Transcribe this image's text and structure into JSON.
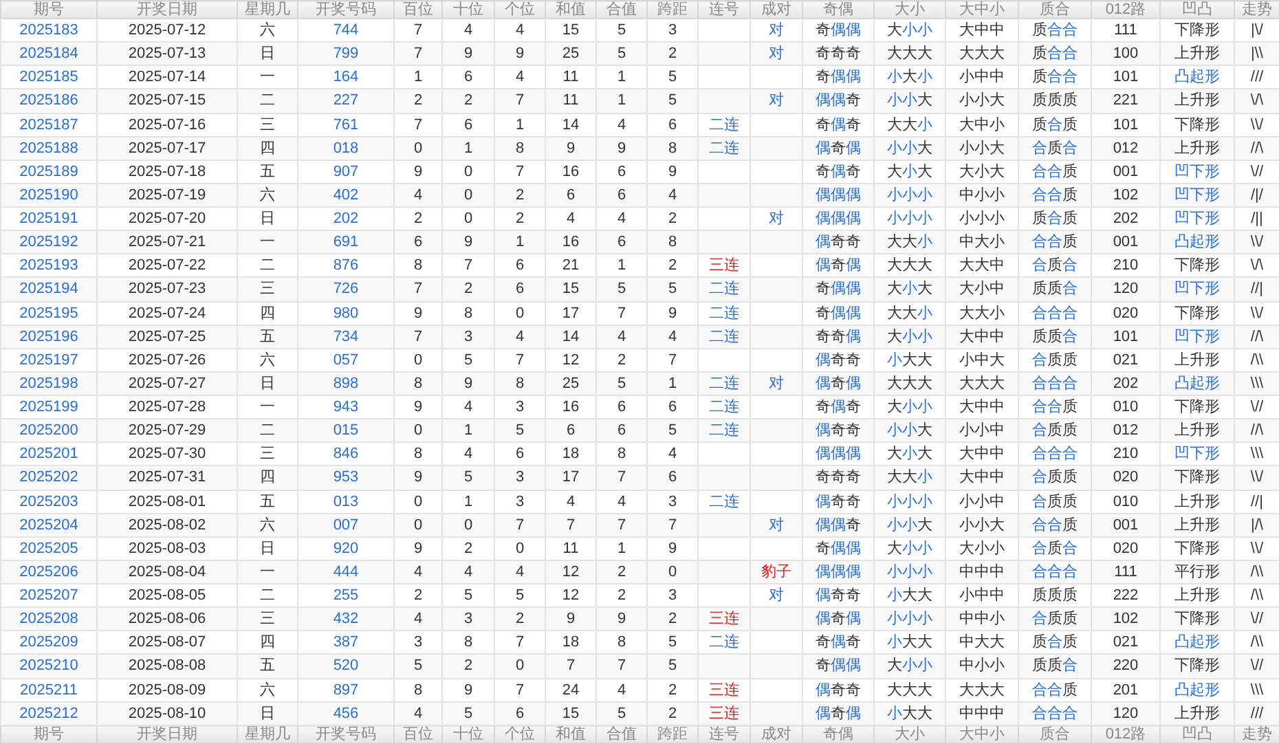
{
  "columns": [
    "期号",
    "开奖日期",
    "星期几",
    "开奖号码",
    "百位",
    "十位",
    "个位",
    "和值",
    "合值",
    "跨距",
    "连号",
    "成对",
    "奇偶",
    "大小",
    "大中小",
    "质合",
    "012路",
    "凹凸",
    "走势"
  ],
  "rows": [
    {
      "period": "2025183",
      "date": "2025-07-12",
      "weekday": "六",
      "number": "744",
      "hundreds": "7",
      "tens": "4",
      "units": "4",
      "sum": "15",
      "sum_tail": "5",
      "span": "3",
      "odd_even": [
        "奇",
        "偶",
        "偶"
      ],
      "odd_even_accent": [
        false,
        true,
        true
      ],
      "big_small": [
        "大",
        "小",
        "小"
      ],
      "big_small_accent": [
        false,
        true,
        true
      ],
      "big_mid_small": "大中中",
      "prime_composite": [
        "质",
        "合",
        "合"
      ],
      "prime_composite_accent": [
        false,
        true,
        true
      ],
      "route_012": "111",
      "shape": "下降形",
      "shape_accent": false,
      "trend": "|\\/",
      "pair": {
        "text": "对",
        "color": "#2a6fd6"
      }
    },
    {
      "period": "2025184",
      "date": "2025-07-13",
      "weekday": "日",
      "number": "799",
      "hundreds": "7",
      "tens": "9",
      "units": "9",
      "sum": "25",
      "sum_tail": "5",
      "span": "2",
      "odd_even": [
        "奇",
        "奇",
        "奇"
      ],
      "odd_even_accent": [
        false,
        false,
        false
      ],
      "big_small": [
        "大",
        "大",
        "大"
      ],
      "big_small_accent": [
        false,
        false,
        false
      ],
      "big_mid_small": "大大大",
      "prime_composite": [
        "质",
        "合",
        "合"
      ],
      "prime_composite_accent": [
        false,
        true,
        true
      ],
      "route_012": "100",
      "shape": "上升形",
      "shape_accent": false,
      "trend": "|\\\\",
      "pair": {
        "text": "对",
        "color": "#2a6fd6"
      }
    },
    {
      "period": "2025185",
      "date": "2025-07-14",
      "weekday": "一",
      "number": "164",
      "hundreds": "1",
      "tens": "6",
      "units": "4",
      "sum": "11",
      "sum_tail": "1",
      "span": "5",
      "odd_even": [
        "奇",
        "偶",
        "偶"
      ],
      "odd_even_accent": [
        false,
        true,
        true
      ],
      "big_small": [
        "小",
        "大",
        "小"
      ],
      "big_small_accent": [
        true,
        false,
        true
      ],
      "big_mid_small": "小中中",
      "prime_composite": [
        "质",
        "合",
        "合"
      ],
      "prime_composite_accent": [
        false,
        true,
        true
      ],
      "route_012": "101",
      "shape": "凸起形",
      "shape_accent": true,
      "trend": "///"
    },
    {
      "period": "2025186",
      "date": "2025-07-15",
      "weekday": "二",
      "number": "227",
      "hundreds": "2",
      "tens": "2",
      "units": "7",
      "sum": "11",
      "sum_tail": "1",
      "span": "5",
      "odd_even": [
        "偶",
        "偶",
        "奇"
      ],
      "odd_even_accent": [
        true,
        true,
        false
      ],
      "big_small": [
        "小",
        "小",
        "大"
      ],
      "big_small_accent": [
        true,
        true,
        false
      ],
      "big_mid_small": "小小大",
      "prime_composite": [
        "质",
        "质",
        "质"
      ],
      "prime_composite_accent": [
        false,
        false,
        false
      ],
      "route_012": "221",
      "shape": "上升形",
      "shape_accent": false,
      "trend": "\\/\\",
      "pair": {
        "text": "对",
        "color": "#2a6fd6"
      }
    },
    {
      "period": "2025187",
      "date": "2025-07-16",
      "weekday": "三",
      "number": "761",
      "hundreds": "7",
      "tens": "6",
      "units": "1",
      "sum": "14",
      "sum_tail": "4",
      "span": "6",
      "odd_even": [
        "奇",
        "偶",
        "奇"
      ],
      "odd_even_accent": [
        false,
        true,
        false
      ],
      "big_small": [
        "大",
        "大",
        "小"
      ],
      "big_small_accent": [
        false,
        false,
        true
      ],
      "big_mid_small": "大中小",
      "prime_composite": [
        "质",
        "合",
        "质"
      ],
      "prime_composite_accent": [
        false,
        true,
        false
      ],
      "route_012": "101",
      "shape": "下降形",
      "shape_accent": false,
      "trend": "\\\\/",
      "consecutive": {
        "text": "二连",
        "color": "#2a6fd6"
      }
    },
    {
      "period": "2025188",
      "date": "2025-07-17",
      "weekday": "四",
      "number": "018",
      "hundreds": "0",
      "tens": "1",
      "units": "8",
      "sum": "9",
      "sum_tail": "9",
      "span": "8",
      "odd_even": [
        "偶",
        "奇",
        "偶"
      ],
      "odd_even_accent": [
        true,
        false,
        true
      ],
      "big_small": [
        "小",
        "小",
        "大"
      ],
      "big_small_accent": [
        true,
        true,
        false
      ],
      "big_mid_small": "小小大",
      "prime_composite": [
        "合",
        "质",
        "合"
      ],
      "prime_composite_accent": [
        true,
        false,
        true
      ],
      "route_012": "012",
      "shape": "上升形",
      "shape_accent": false,
      "trend": "//\\",
      "consecutive": {
        "text": "二连",
        "color": "#2a6fd6"
      }
    },
    {
      "period": "2025189",
      "date": "2025-07-18",
      "weekday": "五",
      "number": "907",
      "hundreds": "9",
      "tens": "0",
      "units": "7",
      "sum": "16",
      "sum_tail": "6",
      "span": "9",
      "odd_even": [
        "奇",
        "偶",
        "奇"
      ],
      "odd_even_accent": [
        false,
        true,
        false
      ],
      "big_small": [
        "大",
        "小",
        "大"
      ],
      "big_small_accent": [
        false,
        true,
        false
      ],
      "big_mid_small": "大小大",
      "prime_composite": [
        "合",
        "合",
        "质"
      ],
      "prime_composite_accent": [
        true,
        true,
        false
      ],
      "route_012": "001",
      "shape": "凹下形",
      "shape_accent": true,
      "trend": "\\//"
    },
    {
      "period": "2025190",
      "date": "2025-07-19",
      "weekday": "六",
      "number": "402",
      "hundreds": "4",
      "tens": "0",
      "units": "2",
      "sum": "6",
      "sum_tail": "6",
      "span": "4",
      "odd_even": [
        "偶",
        "偶",
        "偶"
      ],
      "odd_even_accent": [
        true,
        true,
        true
      ],
      "big_small": [
        "小",
        "小",
        "小"
      ],
      "big_small_accent": [
        true,
        true,
        true
      ],
      "big_mid_small": "中小小",
      "prime_composite": [
        "合",
        "合",
        "质"
      ],
      "prime_composite_accent": [
        true,
        true,
        false
      ],
      "route_012": "102",
      "shape": "凹下形",
      "shape_accent": true,
      "trend": "/|/"
    },
    {
      "period": "2025191",
      "date": "2025-07-20",
      "weekday": "日",
      "number": "202",
      "hundreds": "2",
      "tens": "0",
      "units": "2",
      "sum": "4",
      "sum_tail": "4",
      "span": "2",
      "odd_even": [
        "偶",
        "偶",
        "偶"
      ],
      "odd_even_accent": [
        true,
        true,
        true
      ],
      "big_small": [
        "小",
        "小",
        "小"
      ],
      "big_small_accent": [
        true,
        true,
        true
      ],
      "big_mid_small": "小小小",
      "prime_composite": [
        "质",
        "合",
        "质"
      ],
      "prime_composite_accent": [
        false,
        true,
        false
      ],
      "route_012": "202",
      "shape": "凹下形",
      "shape_accent": true,
      "trend": "/||",
      "pair": {
        "text": "对",
        "color": "#2a6fd6"
      }
    },
    {
      "period": "2025192",
      "date": "2025-07-21",
      "weekday": "一",
      "number": "691",
      "hundreds": "6",
      "tens": "9",
      "units": "1",
      "sum": "16",
      "sum_tail": "6",
      "span": "8",
      "odd_even": [
        "偶",
        "奇",
        "奇"
      ],
      "odd_even_accent": [
        true,
        false,
        false
      ],
      "big_small": [
        "大",
        "大",
        "小"
      ],
      "big_small_accent": [
        false,
        false,
        true
      ],
      "big_mid_small": "中大小",
      "prime_composite": [
        "合",
        "合",
        "质"
      ],
      "prime_composite_accent": [
        true,
        true,
        false
      ],
      "route_012": "001",
      "shape": "凸起形",
      "shape_accent": true,
      "trend": "\\\\/"
    },
    {
      "period": "2025193",
      "date": "2025-07-22",
      "weekday": "二",
      "number": "876",
      "hundreds": "8",
      "tens": "7",
      "units": "6",
      "sum": "21",
      "sum_tail": "1",
      "span": "2",
      "odd_even": [
        "偶",
        "奇",
        "偶"
      ],
      "odd_even_accent": [
        true,
        false,
        true
      ],
      "big_small": [
        "大",
        "大",
        "大"
      ],
      "big_small_accent": [
        false,
        false,
        false
      ],
      "big_mid_small": "大大中",
      "prime_composite": [
        "合",
        "质",
        "合"
      ],
      "prime_composite_accent": [
        true,
        false,
        true
      ],
      "route_012": "210",
      "shape": "下降形",
      "shape_accent": false,
      "trend": "\\/\\",
      "consecutive": {
        "text": "三连",
        "color": "#e02020"
      }
    },
    {
      "period": "2025194",
      "date": "2025-07-23",
      "weekday": "三",
      "number": "726",
      "hundreds": "7",
      "tens": "2",
      "units": "6",
      "sum": "15",
      "sum_tail": "5",
      "span": "5",
      "odd_even": [
        "奇",
        "偶",
        "偶"
      ],
      "odd_even_accent": [
        false,
        true,
        true
      ],
      "big_small": [
        "大",
        "小",
        "大"
      ],
      "big_small_accent": [
        false,
        true,
        false
      ],
      "big_mid_small": "大小中",
      "prime_composite": [
        "质",
        "质",
        "合"
      ],
      "prime_composite_accent": [
        false,
        false,
        true
      ],
      "route_012": "120",
      "shape": "凹下形",
      "shape_accent": true,
      "trend": "//|",
      "consecutive": {
        "text": "二连",
        "color": "#2a6fd6"
      }
    },
    {
      "period": "2025195",
      "date": "2025-07-24",
      "weekday": "四",
      "number": "980",
      "hundreds": "9",
      "tens": "8",
      "units": "0",
      "sum": "17",
      "sum_tail": "7",
      "span": "9",
      "odd_even": [
        "奇",
        "偶",
        "偶"
      ],
      "odd_even_accent": [
        false,
        true,
        true
      ],
      "big_small": [
        "大",
        "大",
        "小"
      ],
      "big_small_accent": [
        false,
        false,
        true
      ],
      "big_mid_small": "大大小",
      "prime_composite": [
        "合",
        "合",
        "合"
      ],
      "prime_composite_accent": [
        true,
        true,
        true
      ],
      "route_012": "020",
      "shape": "下降形",
      "shape_accent": false,
      "trend": "\\\\/",
      "consecutive": {
        "text": "二连",
        "color": "#2a6fd6"
      }
    },
    {
      "period": "2025196",
      "date": "2025-07-25",
      "weekday": "五",
      "number": "734",
      "hundreds": "7",
      "tens": "3",
      "units": "4",
      "sum": "14",
      "sum_tail": "4",
      "span": "4",
      "odd_even": [
        "奇",
        "奇",
        "偶"
      ],
      "odd_even_accent": [
        false,
        false,
        true
      ],
      "big_small": [
        "大",
        "小",
        "小"
      ],
      "big_small_accent": [
        false,
        true,
        true
      ],
      "big_mid_small": "大中中",
      "prime_composite": [
        "质",
        "质",
        "合"
      ],
      "prime_composite_accent": [
        false,
        false,
        true
      ],
      "route_012": "101",
      "shape": "凹下形",
      "shape_accent": true,
      "trend": "//\\",
      "consecutive": {
        "text": "二连",
        "color": "#2a6fd6"
      }
    },
    {
      "period": "2025197",
      "date": "2025-07-26",
      "weekday": "六",
      "number": "057",
      "hundreds": "0",
      "tens": "5",
      "units": "7",
      "sum": "12",
      "sum_tail": "2",
      "span": "7",
      "odd_even": [
        "偶",
        "奇",
        "奇"
      ],
      "odd_even_accent": [
        true,
        false,
        false
      ],
      "big_small": [
        "小",
        "大",
        "大"
      ],
      "big_small_accent": [
        true,
        false,
        false
      ],
      "big_mid_small": "小中大",
      "prime_composite": [
        "合",
        "质",
        "质"
      ],
      "prime_composite_accent": [
        true,
        false,
        false
      ],
      "route_012": "021",
      "shape": "上升形",
      "shape_accent": false,
      "trend": "/\\\\"
    },
    {
      "period": "2025198",
      "date": "2025-07-27",
      "weekday": "日",
      "number": "898",
      "hundreds": "8",
      "tens": "9",
      "units": "8",
      "sum": "25",
      "sum_tail": "5",
      "span": "1",
      "odd_even": [
        "偶",
        "奇",
        "偶"
      ],
      "odd_even_accent": [
        true,
        false,
        true
      ],
      "big_small": [
        "大",
        "大",
        "大"
      ],
      "big_small_accent": [
        false,
        false,
        false
      ],
      "big_mid_small": "大大大",
      "prime_composite": [
        "合",
        "合",
        "合"
      ],
      "prime_composite_accent": [
        true,
        true,
        true
      ],
      "route_012": "202",
      "shape": "凸起形",
      "shape_accent": true,
      "trend": "\\\\\\",
      "consecutive": {
        "text": "二连",
        "color": "#2a6fd6"
      },
      "pair": {
        "text": "对",
        "color": "#2a6fd6"
      }
    },
    {
      "period": "2025199",
      "date": "2025-07-28",
      "weekday": "一",
      "number": "943",
      "hundreds": "9",
      "tens": "4",
      "units": "3",
      "sum": "16",
      "sum_tail": "6",
      "span": "6",
      "odd_even": [
        "奇",
        "偶",
        "奇"
      ],
      "odd_even_accent": [
        false,
        true,
        false
      ],
      "big_small": [
        "大",
        "小",
        "小"
      ],
      "big_small_accent": [
        false,
        true,
        true
      ],
      "big_mid_small": "大中中",
      "prime_composite": [
        "合",
        "合",
        "质"
      ],
      "prime_composite_accent": [
        true,
        true,
        false
      ],
      "route_012": "010",
      "shape": "下降形",
      "shape_accent": false,
      "trend": "\\//",
      "consecutive": {
        "text": "二连",
        "color": "#2a6fd6"
      }
    },
    {
      "period": "2025200",
      "date": "2025-07-29",
      "weekday": "二",
      "number": "015",
      "hundreds": "0",
      "tens": "1",
      "units": "5",
      "sum": "6",
      "sum_tail": "6",
      "span": "5",
      "odd_even": [
        "偶",
        "奇",
        "奇"
      ],
      "odd_even_accent": [
        true,
        false,
        false
      ],
      "big_small": [
        "小",
        "小",
        "大"
      ],
      "big_small_accent": [
        true,
        true,
        false
      ],
      "big_mid_small": "小小中",
      "prime_composite": [
        "合",
        "质",
        "质"
      ],
      "prime_composite_accent": [
        true,
        false,
        false
      ],
      "route_012": "012",
      "shape": "上升形",
      "shape_accent": false,
      "trend": "//\\",
      "consecutive": {
        "text": "二连",
        "color": "#2a6fd6"
      }
    },
    {
      "period": "2025201",
      "date": "2025-07-30",
      "weekday": "三",
      "number": "846",
      "hundreds": "8",
      "tens": "4",
      "units": "6",
      "sum": "18",
      "sum_tail": "8",
      "span": "4",
      "odd_even": [
        "偶",
        "偶",
        "偶"
      ],
      "odd_even_accent": [
        true,
        true,
        true
      ],
      "big_small": [
        "大",
        "小",
        "大"
      ],
      "big_small_accent": [
        false,
        true,
        false
      ],
      "big_mid_small": "大中中",
      "prime_composite": [
        "合",
        "合",
        "合"
      ],
      "prime_composite_accent": [
        true,
        true,
        true
      ],
      "route_012": "210",
      "shape": "凹下形",
      "shape_accent": true,
      "trend": "\\\\\\"
    },
    {
      "period": "2025202",
      "date": "2025-07-31",
      "weekday": "四",
      "number": "953",
      "hundreds": "9",
      "tens": "5",
      "units": "3",
      "sum": "17",
      "sum_tail": "7",
      "span": "6",
      "odd_even": [
        "奇",
        "奇",
        "奇"
      ],
      "odd_even_accent": [
        false,
        false,
        false
      ],
      "big_small": [
        "大",
        "大",
        "小"
      ],
      "big_small_accent": [
        false,
        false,
        true
      ],
      "big_mid_small": "大中中",
      "prime_composite": [
        "合",
        "质",
        "质"
      ],
      "prime_composite_accent": [
        true,
        false,
        false
      ],
      "route_012": "020",
      "shape": "下降形",
      "shape_accent": false,
      "trend": "\\\\/"
    },
    {
      "period": "2025203",
      "date": "2025-08-01",
      "weekday": "五",
      "number": "013",
      "hundreds": "0",
      "tens": "1",
      "units": "3",
      "sum": "4",
      "sum_tail": "4",
      "span": "3",
      "odd_even": [
        "偶",
        "奇",
        "奇"
      ],
      "odd_even_accent": [
        true,
        false,
        false
      ],
      "big_small": [
        "小",
        "小",
        "小"
      ],
      "big_small_accent": [
        true,
        true,
        true
      ],
      "big_mid_small": "小小中",
      "prime_composite": [
        "合",
        "质",
        "质"
      ],
      "prime_composite_accent": [
        true,
        false,
        false
      ],
      "route_012": "010",
      "shape": "上升形",
      "shape_accent": false,
      "trend": "//|",
      "consecutive": {
        "text": "二连",
        "color": "#2a6fd6"
      }
    },
    {
      "period": "2025204",
      "date": "2025-08-02",
      "weekday": "六",
      "number": "007",
      "hundreds": "0",
      "tens": "0",
      "units": "7",
      "sum": "7",
      "sum_tail": "7",
      "span": "7",
      "odd_even": [
        "偶",
        "偶",
        "奇"
      ],
      "odd_even_accent": [
        true,
        true,
        false
      ],
      "big_small": [
        "小",
        "小",
        "大"
      ],
      "big_small_accent": [
        true,
        true,
        false
      ],
      "big_mid_small": "小小大",
      "prime_composite": [
        "合",
        "合",
        "质"
      ],
      "prime_composite_accent": [
        true,
        true,
        false
      ],
      "route_012": "001",
      "shape": "上升形",
      "shape_accent": false,
      "trend": "|/\\",
      "pair": {
        "text": "对",
        "color": "#2a6fd6"
      }
    },
    {
      "period": "2025205",
      "date": "2025-08-03",
      "weekday": "日",
      "number": "920",
      "hundreds": "9",
      "tens": "2",
      "units": "0",
      "sum": "11",
      "sum_tail": "1",
      "span": "9",
      "odd_even": [
        "奇",
        "偶",
        "偶"
      ],
      "odd_even_accent": [
        false,
        true,
        true
      ],
      "big_small": [
        "大",
        "小",
        "小"
      ],
      "big_small_accent": [
        false,
        true,
        true
      ],
      "big_mid_small": "大小小",
      "prime_composite": [
        "合",
        "质",
        "合"
      ],
      "prime_composite_accent": [
        true,
        false,
        true
      ],
      "route_012": "020",
      "shape": "下降形",
      "shape_accent": false,
      "trend": "\\\\/"
    },
    {
      "period": "2025206",
      "date": "2025-08-04",
      "weekday": "一",
      "number": "444",
      "hundreds": "4",
      "tens": "4",
      "units": "4",
      "sum": "12",
      "sum_tail": "2",
      "span": "0",
      "odd_even": [
        "偶",
        "偶",
        "偶"
      ],
      "odd_even_accent": [
        true,
        true,
        true
      ],
      "big_small": [
        "小",
        "小",
        "小"
      ],
      "big_small_accent": [
        true,
        true,
        true
      ],
      "big_mid_small": "中中中",
      "prime_composite": [
        "合",
        "合",
        "合"
      ],
      "prime_composite_accent": [
        true,
        true,
        true
      ],
      "route_012": "111",
      "shape": "平行形",
      "shape_accent": false,
      "trend": "/\\\\",
      "pair": {
        "text": "豹子",
        "color": "#e02020"
      }
    },
    {
      "period": "2025207",
      "date": "2025-08-05",
      "weekday": "二",
      "number": "255",
      "hundreds": "2",
      "tens": "5",
      "units": "5",
      "sum": "12",
      "sum_tail": "2",
      "span": "3",
      "odd_even": [
        "偶",
        "奇",
        "奇"
      ],
      "odd_even_accent": [
        true,
        false,
        false
      ],
      "big_small": [
        "小",
        "大",
        "大"
      ],
      "big_small_accent": [
        true,
        false,
        false
      ],
      "big_mid_small": "小中中",
      "prime_composite": [
        "质",
        "质",
        "质"
      ],
      "prime_composite_accent": [
        false,
        false,
        false
      ],
      "route_012": "222",
      "shape": "上升形",
      "shape_accent": false,
      "trend": "/\\\\",
      "pair": {
        "text": "对",
        "color": "#2a6fd6"
      }
    },
    {
      "period": "2025208",
      "date": "2025-08-06",
      "weekday": "三",
      "number": "432",
      "hundreds": "4",
      "tens": "3",
      "units": "2",
      "sum": "9",
      "sum_tail": "9",
      "span": "2",
      "odd_even": [
        "偶",
        "奇",
        "偶"
      ],
      "odd_even_accent": [
        true,
        false,
        true
      ],
      "big_small": [
        "小",
        "小",
        "小"
      ],
      "big_small_accent": [
        true,
        true,
        true
      ],
      "big_mid_small": "中中小",
      "prime_composite": [
        "合",
        "质",
        "质"
      ],
      "prime_composite_accent": [
        true,
        false,
        false
      ],
      "route_012": "102",
      "shape": "下降形",
      "shape_accent": false,
      "trend": "\\//",
      "consecutive": {
        "text": "三连",
        "color": "#e02020"
      }
    },
    {
      "period": "2025209",
      "date": "2025-08-07",
      "weekday": "四",
      "number": "387",
      "hundreds": "3",
      "tens": "8",
      "units": "7",
      "sum": "18",
      "sum_tail": "8",
      "span": "5",
      "odd_even": [
        "奇",
        "偶",
        "奇"
      ],
      "odd_even_accent": [
        false,
        true,
        false
      ],
      "big_small": [
        "小",
        "大",
        "大"
      ],
      "big_small_accent": [
        true,
        false,
        false
      ],
      "big_mid_small": "中大大",
      "prime_composite": [
        "质",
        "合",
        "质"
      ],
      "prime_composite_accent": [
        false,
        true,
        false
      ],
      "route_012": "021",
      "shape": "凸起形",
      "shape_accent": true,
      "trend": "/\\\\",
      "consecutive": {
        "text": "二连",
        "color": "#2a6fd6"
      }
    },
    {
      "period": "2025210",
      "date": "2025-08-08",
      "weekday": "五",
      "number": "520",
      "hundreds": "5",
      "tens": "2",
      "units": "0",
      "sum": "7",
      "sum_tail": "7",
      "span": "5",
      "odd_even": [
        "奇",
        "偶",
        "偶"
      ],
      "odd_even_accent": [
        false,
        true,
        true
      ],
      "big_small": [
        "大",
        "小",
        "小"
      ],
      "big_small_accent": [
        false,
        true,
        true
      ],
      "big_mid_small": "中小小",
      "prime_composite": [
        "质",
        "质",
        "合"
      ],
      "prime_composite_accent": [
        false,
        false,
        true
      ],
      "route_012": "220",
      "shape": "下降形",
      "shape_accent": false,
      "trend": "\\//"
    },
    {
      "period": "2025211",
      "date": "2025-08-09",
      "weekday": "六",
      "number": "897",
      "hundreds": "8",
      "tens": "9",
      "units": "7",
      "sum": "24",
      "sum_tail": "4",
      "span": "2",
      "odd_even": [
        "偶",
        "奇",
        "奇"
      ],
      "odd_even_accent": [
        true,
        false,
        false
      ],
      "big_small": [
        "大",
        "大",
        "大"
      ],
      "big_small_accent": [
        false,
        false,
        false
      ],
      "big_mid_small": "大大大",
      "prime_composite": [
        "合",
        "合",
        "质"
      ],
      "prime_composite_accent": [
        true,
        true,
        false
      ],
      "route_012": "201",
      "shape": "凸起形",
      "shape_accent": true,
      "trend": "\\\\\\",
      "consecutive": {
        "text": "三连",
        "color": "#e02020"
      }
    },
    {
      "period": "2025212",
      "date": "2025-08-10",
      "weekday": "日",
      "number": "456",
      "hundreds": "4",
      "tens": "5",
      "units": "6",
      "sum": "15",
      "sum_tail": "5",
      "span": "2",
      "odd_even": [
        "偶",
        "奇",
        "偶"
      ],
      "odd_even_accent": [
        true,
        false,
        true
      ],
      "big_small": [
        "小",
        "大",
        "大"
      ],
      "big_small_accent": [
        true,
        false,
        false
      ],
      "big_mid_small": "中中中",
      "prime_composite": [
        "合",
        "合",
        "合"
      ],
      "prime_composite_accent": [
        true,
        true,
        true
      ],
      "route_012": "120",
      "shape": "上升形",
      "shape_accent": false,
      "trend": "///",
      "consecutive": {
        "text": "三连",
        "color": "#e02020"
      }
    }
  ],
  "footer_columns": [
    "期号",
    "开奖日期",
    "星期几",
    "开奖号码",
    "百位",
    "十位",
    "个位",
    "和值",
    "合值",
    "跨距",
    "连号",
    "成对",
    "奇偶",
    "大小",
    "大中小",
    "质合",
    "012路",
    "凹凸",
    "走势"
  ]
}
